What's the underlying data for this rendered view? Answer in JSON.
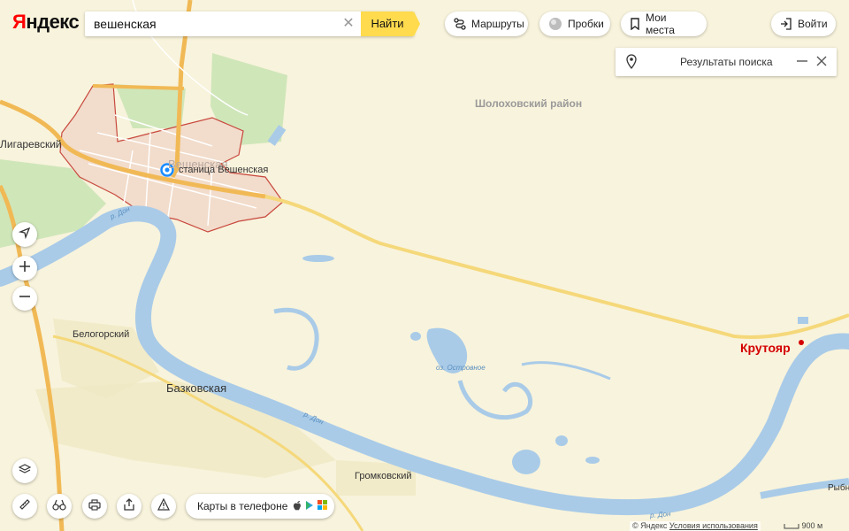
{
  "header": {
    "logo_first": "Я",
    "logo_rest": "ндекс",
    "search": {
      "value": "вешенская",
      "find_label": "Найти"
    },
    "routes_label": "Маршруты",
    "traffic_label": "Пробки",
    "places_label": "Мои места",
    "login_label": "Войти"
  },
  "results_panel": {
    "title": "Результаты поиска"
  },
  "map": {
    "labels": {
      "district": "Шолоховский район",
      "ligarevsky": "Лигаревский",
      "veshenskaya": "Вешенская",
      "station": "станица Вешенская",
      "belogorsky": "Белогорский",
      "bazkovskaya": "Базковская",
      "gromkovsky": "Громковский",
      "krutoyar": "Крутояр",
      "rybny": "Рыбн",
      "lake": "оз. Островное",
      "river1": "р. Дон",
      "river2": "р. Дон",
      "river3": "р. Дон"
    },
    "colors": {
      "land": "#f8f3dc",
      "water": "#a9cbe8",
      "forest": "#cfe6b9",
      "road": "#f5d87a",
      "highway": "#f1b955",
      "boundary": "#c8483e"
    }
  },
  "bottom": {
    "phone_label": "Карты в телефоне",
    "copyright": "© Яндекс",
    "terms": "Условия использования",
    "scale": "900 м"
  }
}
